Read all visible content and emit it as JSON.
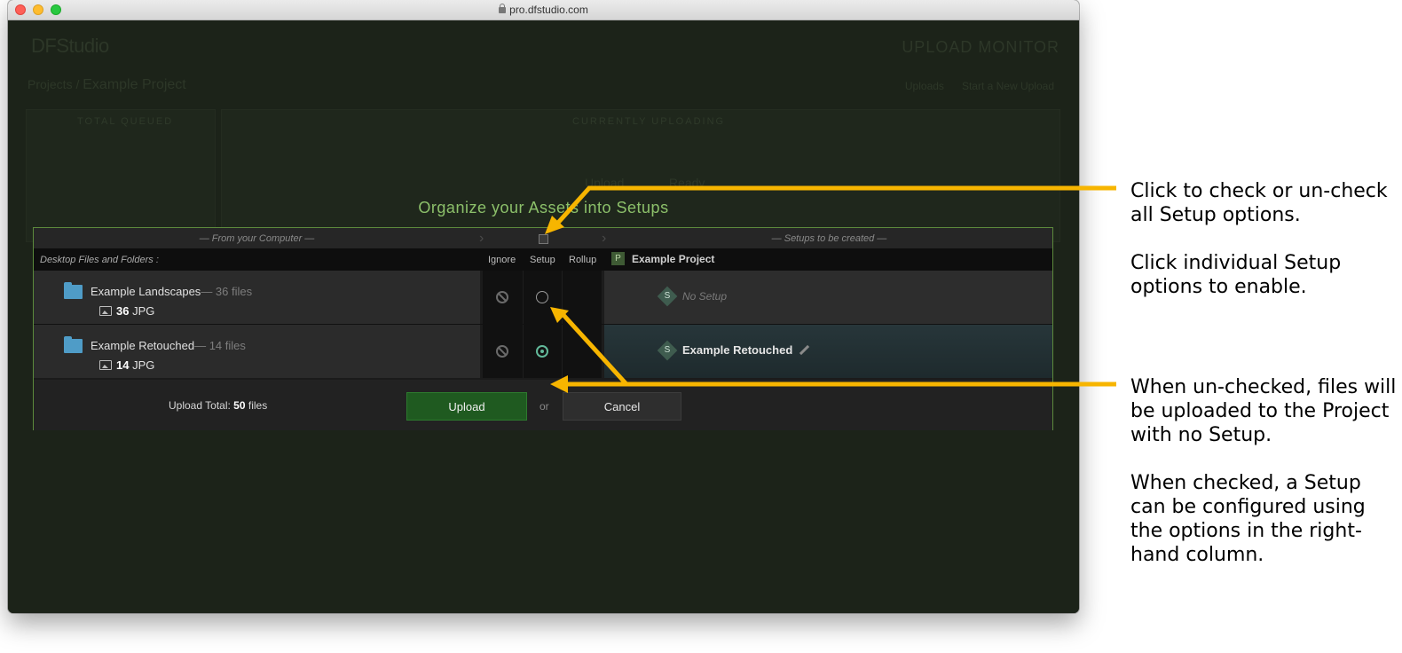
{
  "browser": {
    "url": "pro.dfstudio.com"
  },
  "app": {
    "logo": "DFStudio",
    "page_title": "UPLOAD MONITOR",
    "breadcrumb_prefix": "Projects  /",
    "breadcrumb_project": "Example Project",
    "top_link_view": "Uploads",
    "top_link_start": "Start a New Upload",
    "panel_total_queued": "TOTAL QUEUED",
    "panel_currently_uploading": "CURRENTLY UPLOADING",
    "uploading_message": "Upload ........... Ready"
  },
  "modal": {
    "title": "Organize your Assets into Setups",
    "from_label": "— From your Computer —",
    "to_label": "— Setups to be created —",
    "desktop_label": "Desktop Files and Folders :",
    "col_ignore": "Ignore",
    "col_setup": "Setup",
    "col_rollup": "Rollup",
    "project_badge": "P",
    "project_name": "Example Project",
    "rows": [
      {
        "folder_name": "Example Landscapes",
        "file_count": "— 36 files",
        "type_count": "36",
        "type_ext": "JPG",
        "setup_checked": false,
        "setup_badge": "S",
        "setup_label": "No Setup"
      },
      {
        "folder_name": "Example Retouched",
        "file_count": "— 14 files",
        "type_count": "14",
        "type_ext": "JPG",
        "setup_checked": true,
        "setup_badge": "S",
        "setup_label": "Example Retouched"
      }
    ],
    "upload_total_prefix": "Upload Total:",
    "upload_total_value": "50",
    "upload_total_suffix": "files",
    "upload_button": "Upload",
    "or_label": "or",
    "cancel_button": "Cancel"
  },
  "annotations": {
    "note1_line1": "Click to check or un-check all Setup options.",
    "note1_line2": "Click individual Setup options to enable.",
    "note2_line1": "When un-checked, files will be uploaded to the Project with no Setup.",
    "note2_line2": "When checked, a Setup can be configured using the options in the right-hand column.",
    "arrow_color": "#f7b500"
  },
  "colors": {
    "accent_green": "#8cc06a",
    "folder_blue": "#4f9cc7",
    "radio_teal": "#62b99a"
  }
}
